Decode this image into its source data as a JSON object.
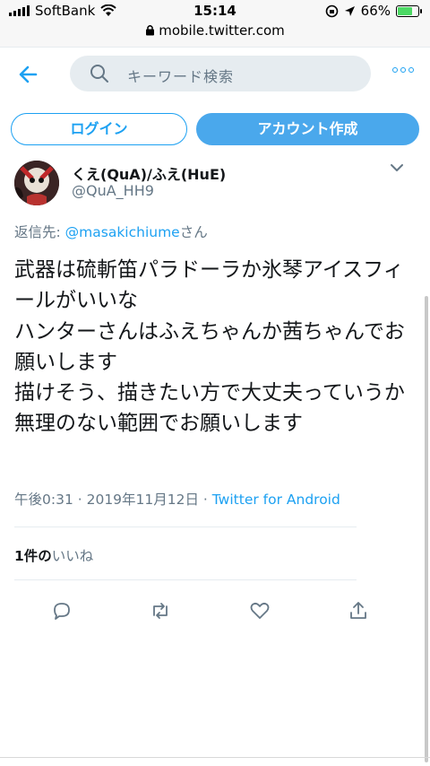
{
  "status_bar": {
    "carrier": "SoftBank",
    "time": "15:14",
    "battery": "66%",
    "battery_level": 0.66,
    "url": "mobile.twitter.com"
  },
  "header": {
    "search_placeholder": "キーワード検索"
  },
  "auth": {
    "login_label": "ログイン",
    "signup_label": "アカウント作成"
  },
  "tweet": {
    "display_name": "くえ(QuA)/ふえ(HuE)",
    "handle": "@QuA_HH9",
    "reply_prefix": "返信先: ",
    "reply_mention": "@masakichiume",
    "reply_suffix": "さん",
    "text": "武器は硫斬笛パラドーラか氷琴アイスフィールがいいな\nハンターさんはふえちゃんか茜ちゃんでお願いします\n描けそう、描きたい方で大丈夫っていうか無理のない範囲でお願いします",
    "time": "午後0:31",
    "date": "2019年11月12日",
    "separator": " · ",
    "source": "Twitter for Android",
    "likes_count": "1件の",
    "likes_label": "いいね"
  },
  "colors": {
    "accent": "#1da1f2",
    "muted": "#657786",
    "signup_bg": "#4aa8ec"
  },
  "icons": {
    "back": "arrow-left-icon",
    "search": "search-icon",
    "more": "more-horizontal-icon",
    "chevron": "chevron-down-icon",
    "reply": "reply-icon",
    "retweet": "retweet-icon",
    "like": "heart-icon",
    "share": "share-icon"
  }
}
